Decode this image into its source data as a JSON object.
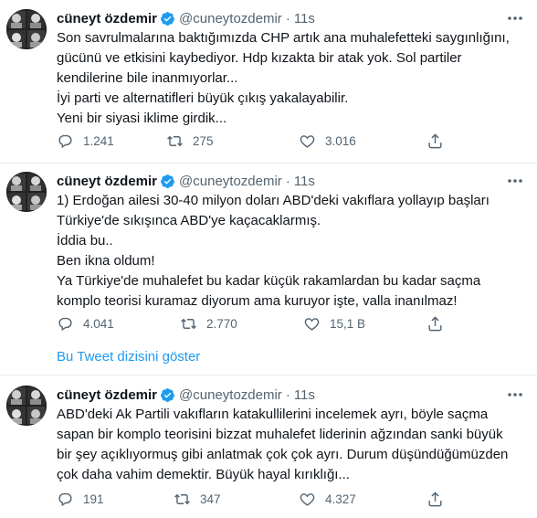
{
  "tweets": [
    {
      "name": "cüneyt özdemir",
      "handle": "@cuneytozdemir",
      "sep": "·",
      "time": "11s",
      "lines": [
        "Son savrulmalarına baktığımızda CHP artık ana muhalefetteki saygınlığını,",
        "gücünü ve etkisini kaybediyor. Hdp kızakta bir atak yok. Sol partiler",
        "kendilerine bile inanmıyorlar...",
        "İyi parti ve alternatifleri büyük çıkış yakalayabilir.",
        "Yeni bir siyasi iklime girdik..."
      ],
      "replies": "1.241",
      "retweets": "275",
      "likes": "3.016"
    },
    {
      "name": "cüneyt özdemir",
      "handle": "@cuneytozdemir",
      "sep": "·",
      "time": "11s",
      "lines": [
        "1) Erdoğan ailesi 30-40 milyon doları ABD'deki vakıflara yollayıp başları",
        "Türkiye'de sıkışınca ABD'ye kaçacaklarmış.",
        "İddia bu..",
        "Ben ikna oldum!",
        "Ya Türkiye'de muhalefet bu kadar küçük rakamlardan bu kadar saçma",
        "komplo teorisi kuramaz diyorum ama kuruyor işte, valla inanılmaz!"
      ],
      "replies": "4.041",
      "retweets": "2.770",
      "likes": "15,1 B",
      "thread_link": "Bu Tweet dizisini göster"
    },
    {
      "name": "cüneyt özdemir",
      "handle": "@cuneytozdemir",
      "sep": "·",
      "time": "11s",
      "lines": [
        "ABD'deki Ak Partili vakıfların katakullilerini incelemek ayrı, böyle saçma",
        "sapan bir komplo teorisini bizzat muhalefet liderinin ağzından sanki büyük",
        "bir şey açıklıyormuş gibi anlatmak çok çok ayrı. Durum düşündüğümüzden",
        "çok daha vahim demektir. Büyük hayal kırıklığı..."
      ],
      "replies": "191",
      "retweets": "347",
      "likes": "4.327"
    }
  ],
  "icons": {
    "reply": "reply-icon",
    "retweet": "retweet-icon",
    "like": "heart-icon",
    "share": "share-icon",
    "verified": "verified-badge-icon",
    "more": "more-options-icon"
  },
  "colors": {
    "text": "#0f1419",
    "secondary": "#536471",
    "link": "#1d9bf0",
    "verified": "#1d9bf0",
    "divider": "#e6ecf0"
  }
}
